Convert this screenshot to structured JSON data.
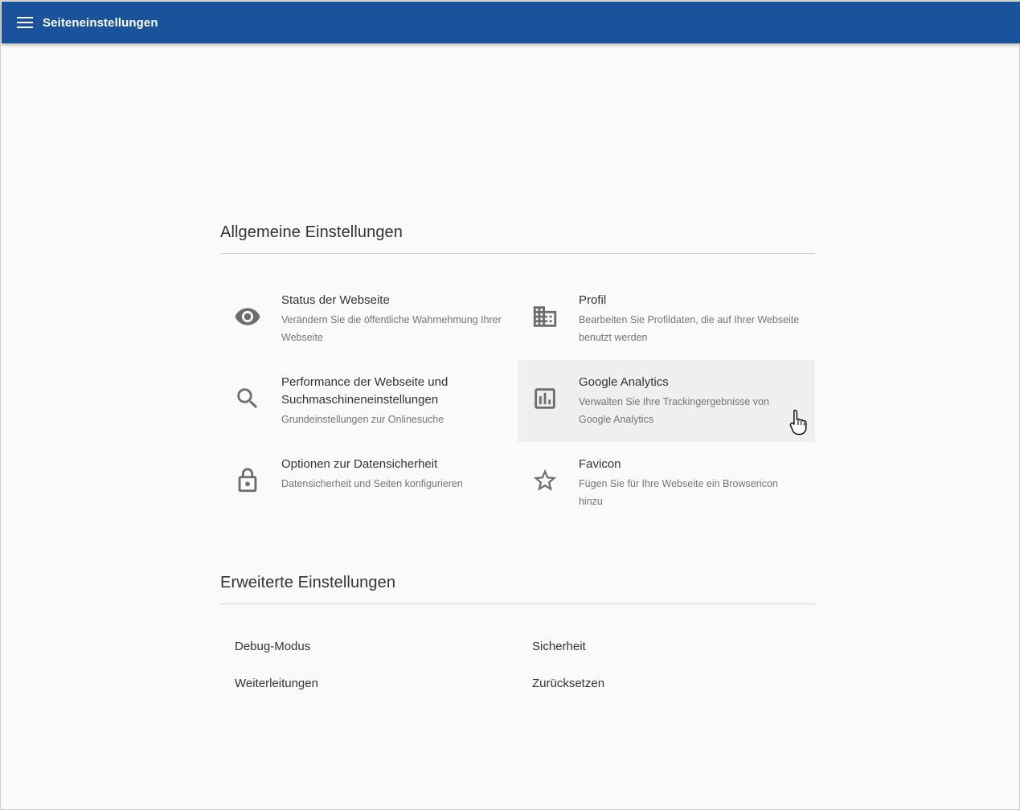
{
  "appbar": {
    "title": "Seiteneinstellungen",
    "menu_icon": "hamburger-menu-icon",
    "color": "#1a539b"
  },
  "general": {
    "heading": "Allgemeine Einstellungen",
    "tiles": [
      {
        "title": "Status der Webseite",
        "description": "Verändern Sie die öffentliche Wahrnehmung Ihrer Webseite",
        "icon": "eye-icon"
      },
      {
        "title": "Profil",
        "description": "Bearbeiten Sie Profildaten, die auf Ihrer Webseite benutzt werden",
        "icon": "building-icon"
      },
      {
        "title": "Performance der Webseite und Suchmaschineneinstellungen",
        "description": "Grundeinstellungen zur Onlinesuche",
        "icon": "search-icon"
      },
      {
        "title": "Google Analytics",
        "description": "Verwalten Sie Ihre Trackingergebnisse von Google Analytics",
        "icon": "bar-chart-icon"
      },
      {
        "title": "Optionen zur Datensicherheit",
        "description": "Datensicherheit und Seiten konfigurieren",
        "icon": "lock-icon"
      },
      {
        "title": "Favicon",
        "description": "Fügen Sie für Ihre Webseite ein Browsericon hinzu",
        "icon": "star-icon"
      }
    ]
  },
  "advanced": {
    "heading": "Erweiterte Einstellungen",
    "links": [
      "Debug-Modus",
      "Sicherheit",
      "Weiterleitungen",
      "Zurücksetzen"
    ]
  }
}
